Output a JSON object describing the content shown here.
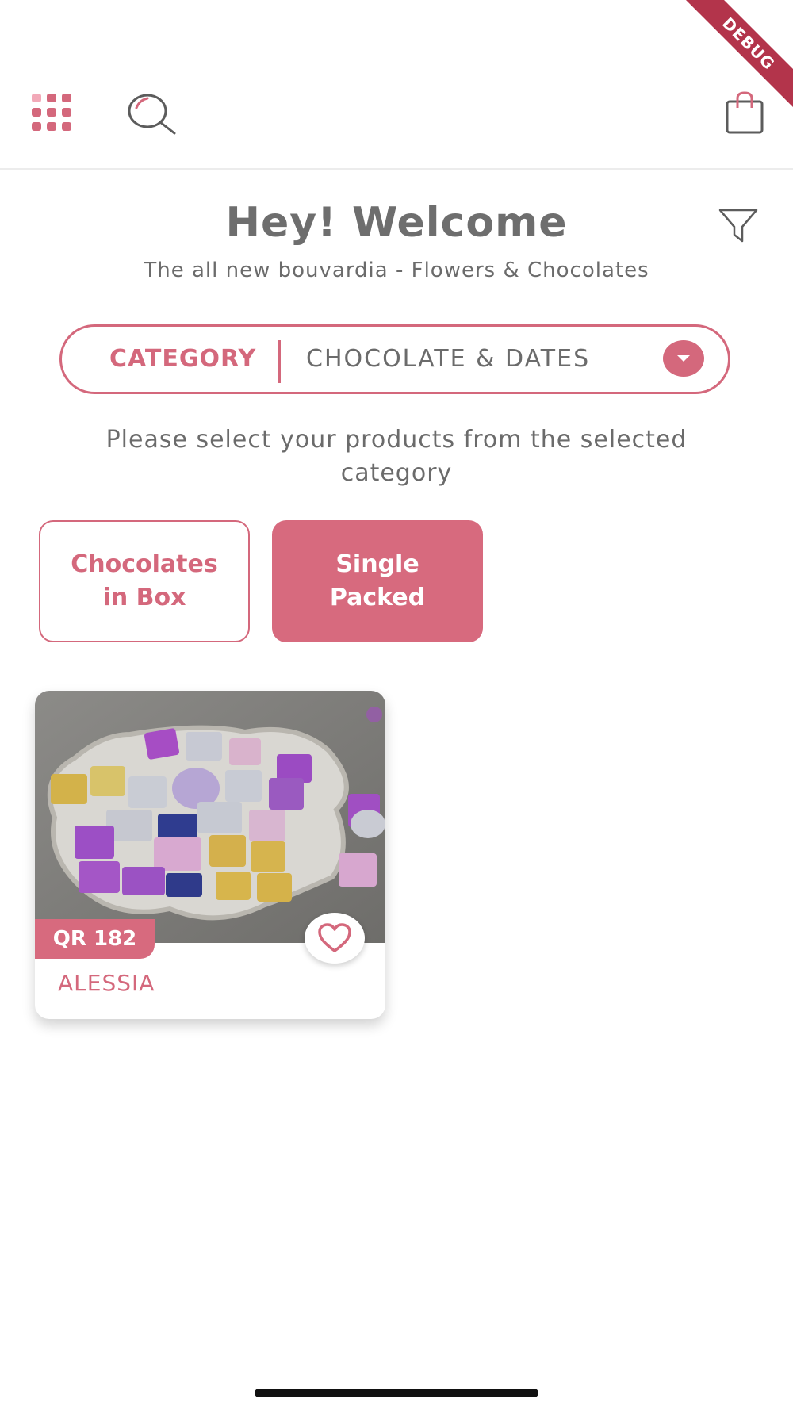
{
  "debug_banner": "DEBUG",
  "header": {
    "title": "Hey! Welcome",
    "subtitle": "The all new bouvardia - Flowers & Chocolates"
  },
  "top_bar": {
    "icons": [
      "grid-menu-icon",
      "search-icon",
      "shopping-bag-icon"
    ]
  },
  "category": {
    "label": "CATEGORY",
    "selected": "CHOCOLATE & DATES"
  },
  "instruction": "Please select your products from the selected category",
  "subcategories": [
    {
      "label": "Chocolates in Box",
      "selected": false
    },
    {
      "label": "Single Packed",
      "selected": true
    }
  ],
  "products": [
    {
      "price": "QR 182",
      "name": "ALESSIA",
      "image": "chocolates-on-star-tray"
    }
  ],
  "colors": {
    "accent": "#d4687c",
    "accent_fill": "#d76a7e",
    "text": "#6b6b6b",
    "debug": "#b3344b"
  }
}
